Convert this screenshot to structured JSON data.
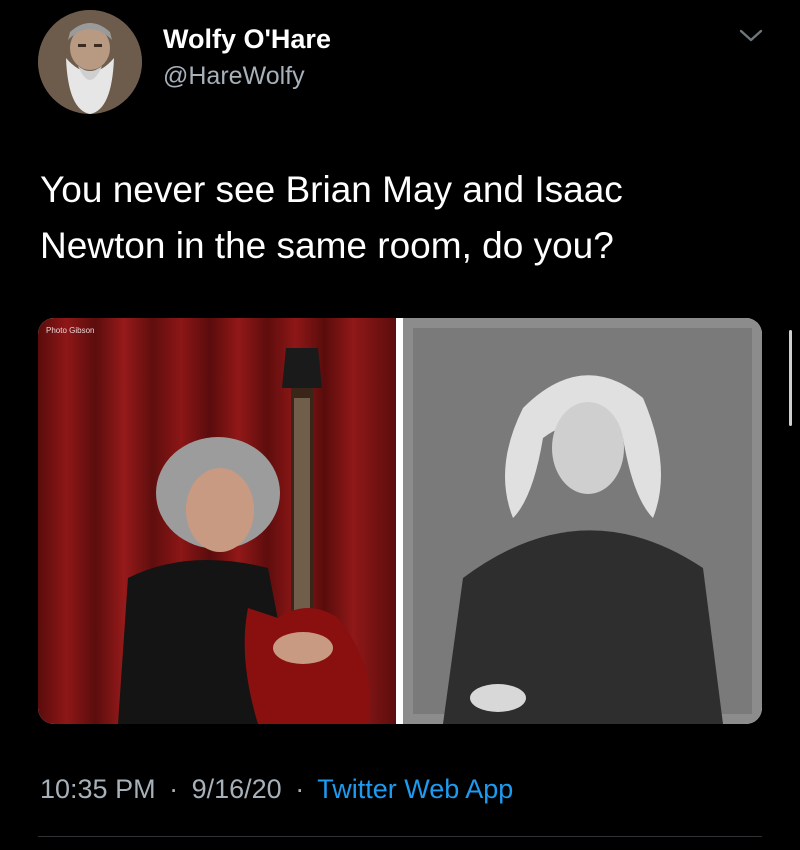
{
  "author": {
    "display_name": "Wolfy O'Hare",
    "handle": "@HareWolfy",
    "avatar_icon": "bearded-man-avatar"
  },
  "tweet": {
    "text": "You never see Brian May and Isaac Newton in the same room, do you?"
  },
  "media": {
    "left_image": {
      "description_icon": "guitarist-photo",
      "photo_credit": "Photo Gibson"
    },
    "right_image": {
      "description_icon": "engraved-portrait"
    }
  },
  "meta": {
    "time": "10:35 PM",
    "separator": "·",
    "date": "9/16/20",
    "source": "Twitter Web App"
  },
  "colors": {
    "background": "#000000",
    "primary_text": "#ffffff",
    "secondary_text": "#a7b1ba",
    "link": "#1d9bf0",
    "divider": "#2f3336"
  }
}
